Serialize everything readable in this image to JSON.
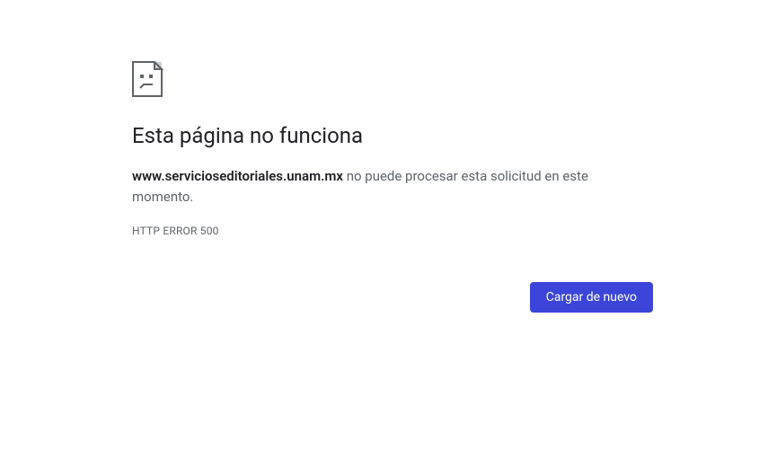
{
  "error": {
    "title": "Esta página no funciona",
    "host": "www.servicioseditoriales.unam.mx",
    "message_after_host": " no puede procesar esta solicitud en este momento.",
    "code_line": "HTTP ERROR 500",
    "reload_label": "Cargar de nuevo"
  }
}
